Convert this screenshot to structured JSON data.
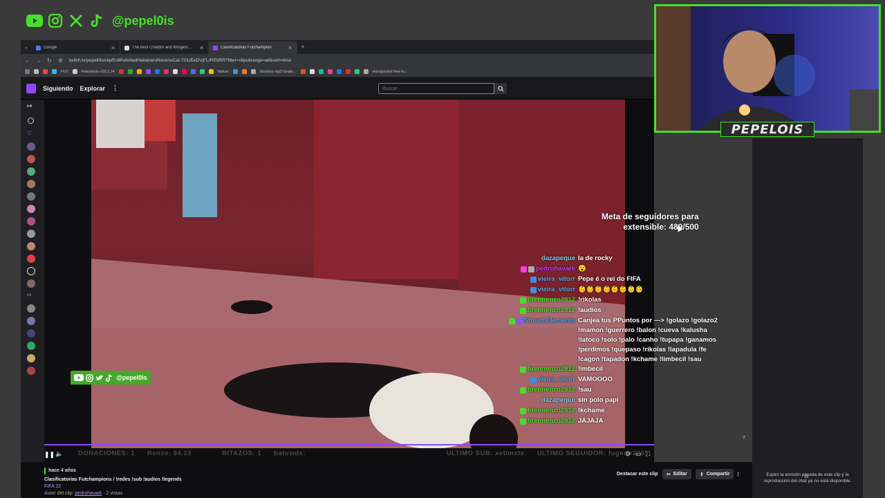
{
  "overlay": {
    "handle": "@pepel0is",
    "icons": [
      "youtube-icon",
      "instagram-icon",
      "x-icon",
      "tiktok-icon"
    ]
  },
  "browser": {
    "tabs": [
      {
        "label": "Google"
      },
      {
        "label": "The best Chatbot and Widgets..."
      },
      {
        "label": "Clasificatorias Futchampion"
      }
    ],
    "url": "twitch.tv/pepel0is/clip/EvilPolishedHabaneroNononoCat-TGUEeDVjFLrRE9RR?filter=clips&range=all&sort=time",
    "bookmarks": [
      "FUT",
      "Palestools v25.1.24",
      "Nofuel",
      "Sonidos mp3 Gratis...",
      "Handpicked free fo..."
    ]
  },
  "twitch": {
    "following": "Siguiendo",
    "explore": "Explorar",
    "more": "⋮",
    "search_placeholder": "Buscar"
  },
  "goal": {
    "line1": "Meta de seguidores para",
    "line2": "extensible: 489/500"
  },
  "chat": [
    {
      "user": "dazapeque",
      "color": "#7ec8e3",
      "msg": "la de rocky",
      "badges": []
    },
    {
      "user": "pedrohavark",
      "color": "#c23cff",
      "msg": "😮",
      "badges": [
        "#ff3ce8",
        "#aaaaaa"
      ]
    },
    {
      "user": "vieira_vitorr",
      "color": "#59a7e0",
      "msg": "Pepe é o rei do FIFA",
      "badges": [
        "#3b8ee0"
      ]
    },
    {
      "user": "vieira_vitorr",
      "color": "#59a7e0",
      "msg": "👶👶👶👶👶👶👶👶",
      "badges": [
        "#3b8ee0"
      ]
    },
    {
      "user": "brennenzo2812",
      "color": "#46e02a",
      "msg": "!rikolas",
      "badges": [
        "#46e02a"
      ]
    },
    {
      "user": "brennenzo2812",
      "color": "#46e02a",
      "msg": "!audios",
      "badges": [
        "#46e02a"
      ]
    },
    {
      "user": "StreamElements",
      "color": "#3ea6ff",
      "msg": "Canjea tus PPuntos por ---> !golazo !golazo2 !mamon !guerrero !balon !cueva !kalusha !latoco !solo !palo !canho !tupapa !ganamos !perdimos !quepaso !rikolas !lapadula !fe !cagon !tapadon !kchame !limbecil !sau",
      "badges": [
        "#46e02a",
        "#7d5bff"
      ]
    },
    {
      "user": "brennenzo2812",
      "color": "#46e02a",
      "msg": "!imbecil",
      "badges": [
        "#46e02a"
      ]
    },
    {
      "user": "vieira_vitorr",
      "color": "#59a7e0",
      "msg": "VAMOOOO",
      "badges": [
        "#3b8ee0"
      ]
    },
    {
      "user": "brennenzo2812",
      "color": "#46e02a",
      "msg": "!sau",
      "badges": [
        "#46e02a"
      ]
    },
    {
      "user": "dazapeque",
      "color": "#7ec8e3",
      "msg": "sin polo papi",
      "badges": []
    },
    {
      "user": "brennenzo2812",
      "color": "#46e02a",
      "msg": "!kchame",
      "badges": [
        "#46e02a"
      ]
    },
    {
      "user": "brennenzo2812",
      "color": "#46e02a",
      "msg": "JAJAJA",
      "badges": [
        "#46e02a"
      ]
    }
  ],
  "stats": {
    "donations": "DONACIONES: 1",
    "renzo": "Renzo: $4.23",
    "bits": "BITAZOS: 1",
    "batuwds": "batuwds:",
    "last_sub": "ULTIMO SUB: xetimxte",
    "last_follower": "ULTIMO SEGUIDOR: fugesjr2003"
  },
  "player": {
    "page_num": "7"
  },
  "clip": {
    "time": "hace 4 años",
    "title": "Clasificatorias Futchampions / !redes !sub !audios !legends",
    "game": "FIFA 22",
    "author_label": "Autor del clip:",
    "author": "pedrohavark",
    "views": "· 2 vistas",
    "actions": {
      "feature": "Destacar este clip",
      "edit": "Editar",
      "share": "Compartir",
      "more": "⋮"
    }
  },
  "webcam": {
    "name": "PEPELOIS"
  },
  "right_panel": {
    "expired": "Expiró la emisión pasada de este clip y la reproducción del chat ya no está disponible."
  },
  "colors": {
    "accent_green": "#46e02a",
    "twitch_purple": "#9147ff"
  }
}
